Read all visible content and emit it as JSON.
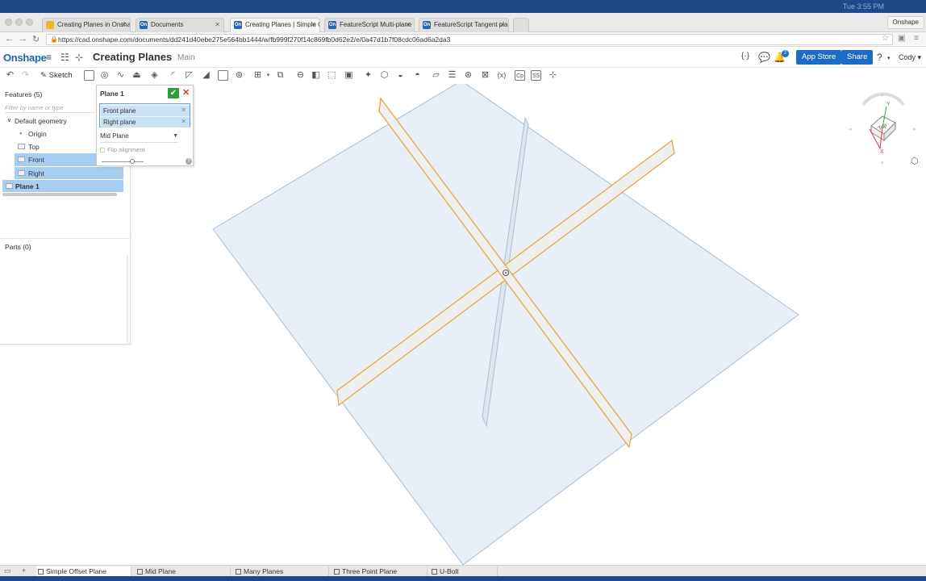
{
  "system": {
    "clock": "Tue 3:55 PM"
  },
  "browser": {
    "tabs": [
      {
        "label": "Creating Planes in Onshape",
        "icon": "drive-icon"
      },
      {
        "label": "Documents",
        "icon": "onshape-icon"
      },
      {
        "label": "Creating Planes | Simple O",
        "icon": "onshape-icon"
      },
      {
        "label": "FeatureScript Multi-plane",
        "icon": "onshape-icon"
      },
      {
        "label": "FeatureScript Tangent pla",
        "icon": "onshape-icon"
      }
    ],
    "profile": "Onshape",
    "url": "https://cad.onshape.com/documents/dd241d40ebe275e564bb1444/w/fb999f270f14c869fb0d62e2/e/0a47d1b7f08cdc06ad6a2da3"
  },
  "header": {
    "logo": "Onshape",
    "title": "Creating Planes",
    "workspace": "Main",
    "notifications": "2",
    "app_store": "App Store",
    "share": "Share",
    "user": "Cody"
  },
  "toolbar": {
    "sketch_label": "Sketch",
    "variable_label": "(x)"
  },
  "features": {
    "title": "Features (5)",
    "filter_placeholder": "Filter by name or type",
    "group": "Default geometry",
    "items": [
      "Origin",
      "Top",
      "Front",
      "Right",
      "Plane 1"
    ],
    "parts_title": "Parts (0)"
  },
  "dialog": {
    "title": "Plane 1",
    "selections": [
      "Front plane",
      "Right plane"
    ],
    "mode": "Mid Plane",
    "flip_label": "Flip alignment",
    "slider_value": 0.7
  },
  "viewcube": {
    "face": "Top",
    "axis_y": "Y",
    "axis_x": "X"
  },
  "colors": {
    "accent": "#1c6cc6",
    "selection": "#a7cdf1",
    "plane_edge": "#e6a23c",
    "plane_fill": "#e8eef5"
  },
  "bottom_tabs": [
    "Simple Offset Plane",
    "Mid Plane",
    "Many Planes",
    "Three Point Plane",
    "U-Bolt"
  ]
}
